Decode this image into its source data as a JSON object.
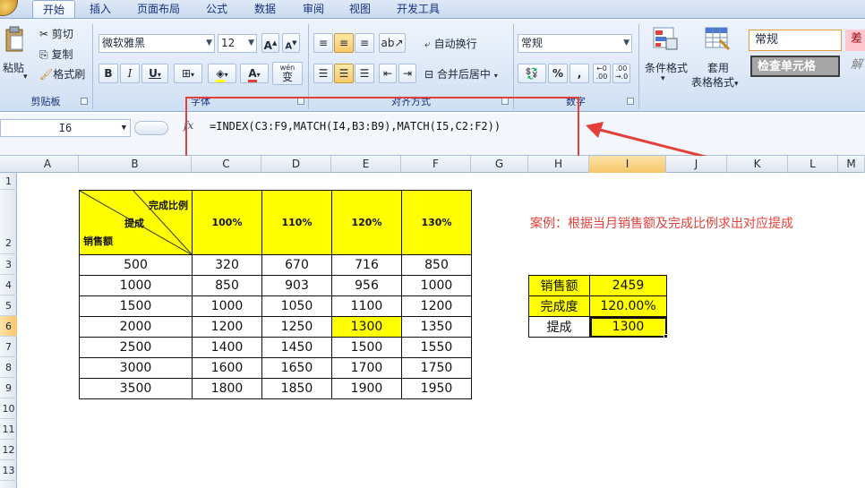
{
  "ribbon": {
    "tabs": [
      "开始",
      "插入",
      "页面布局",
      "公式",
      "数据",
      "审阅",
      "视图",
      "开发工具"
    ],
    "clipboard": {
      "paste": "粘贴",
      "cut": "剪切",
      "copy": "复制",
      "format_painter": "格式刷",
      "label": "剪贴板"
    },
    "font": {
      "name": "微软雅黑",
      "size": "12",
      "bold": "B",
      "italic": "I",
      "underline": "U",
      "wen": "wén",
      "wen_char": "变",
      "label": "字体"
    },
    "alignment": {
      "wrap": "自动换行",
      "merge": "合并后居中",
      "label": "对齐方式"
    },
    "number": {
      "format": "常规",
      "percent": "%",
      "comma": ",",
      "label": "数字"
    },
    "styles": {
      "conditional": "条件格式",
      "table_format_1": "套用",
      "table_format_2": "表格格式",
      "style_normal": "常规",
      "style_bad": "差",
      "style_check": "检查单元格",
      "style_explain": "解"
    }
  },
  "formula_bar": {
    "name_box": "I6",
    "fx": "fx",
    "formula": "=INDEX(C3:F9,MATCH(I4,B3:B9),MATCH(I5,C2:F2))"
  },
  "columns": [
    "A",
    "B",
    "C",
    "D",
    "E",
    "F",
    "G",
    "H",
    "I",
    "J",
    "K",
    "L",
    "M"
  ],
  "rows": [
    "1",
    "2",
    "3",
    "4",
    "5",
    "6",
    "7",
    "8",
    "9",
    "10",
    "11",
    "12",
    "13"
  ],
  "selected": {
    "column": "I",
    "row": "6"
  },
  "main_table": {
    "corner": {
      "top_right": "完成比例",
      "middle": "提成",
      "bottom_left": "销售额"
    },
    "headers": [
      "100%",
      "110%",
      "120%",
      "130%"
    ],
    "rows": [
      {
        "sales": "500",
        "values": [
          "320",
          "670",
          "716",
          "850"
        ]
      },
      {
        "sales": "1000",
        "values": [
          "850",
          "903",
          "956",
          "1000"
        ]
      },
      {
        "sales": "1500",
        "values": [
          "1000",
          "1050",
          "1100",
          "1200"
        ]
      },
      {
        "sales": "2000",
        "values": [
          "1200",
          "1250",
          "1300",
          "1350"
        ]
      },
      {
        "sales": "2500",
        "values": [
          "1400",
          "1450",
          "1500",
          "1550"
        ]
      },
      {
        "sales": "3000",
        "values": [
          "1600",
          "1650",
          "1700",
          "1750"
        ]
      },
      {
        "sales": "3500",
        "values": [
          "1800",
          "1850",
          "1900",
          "1950"
        ]
      }
    ],
    "highlight_color": "#ffff00"
  },
  "lookup": {
    "rows": [
      {
        "label": "销售额",
        "value": "2459"
      },
      {
        "label": "完成度",
        "value": "120.00%"
      },
      {
        "label": "提成",
        "value": "1300"
      }
    ]
  },
  "caption": "案例：根据当月销售额及完成比例求出对应提成",
  "colors": {
    "annotation_red": "#e3403a",
    "yellow": "#ffff00",
    "ribbon_blue": "#dfe9f7"
  }
}
